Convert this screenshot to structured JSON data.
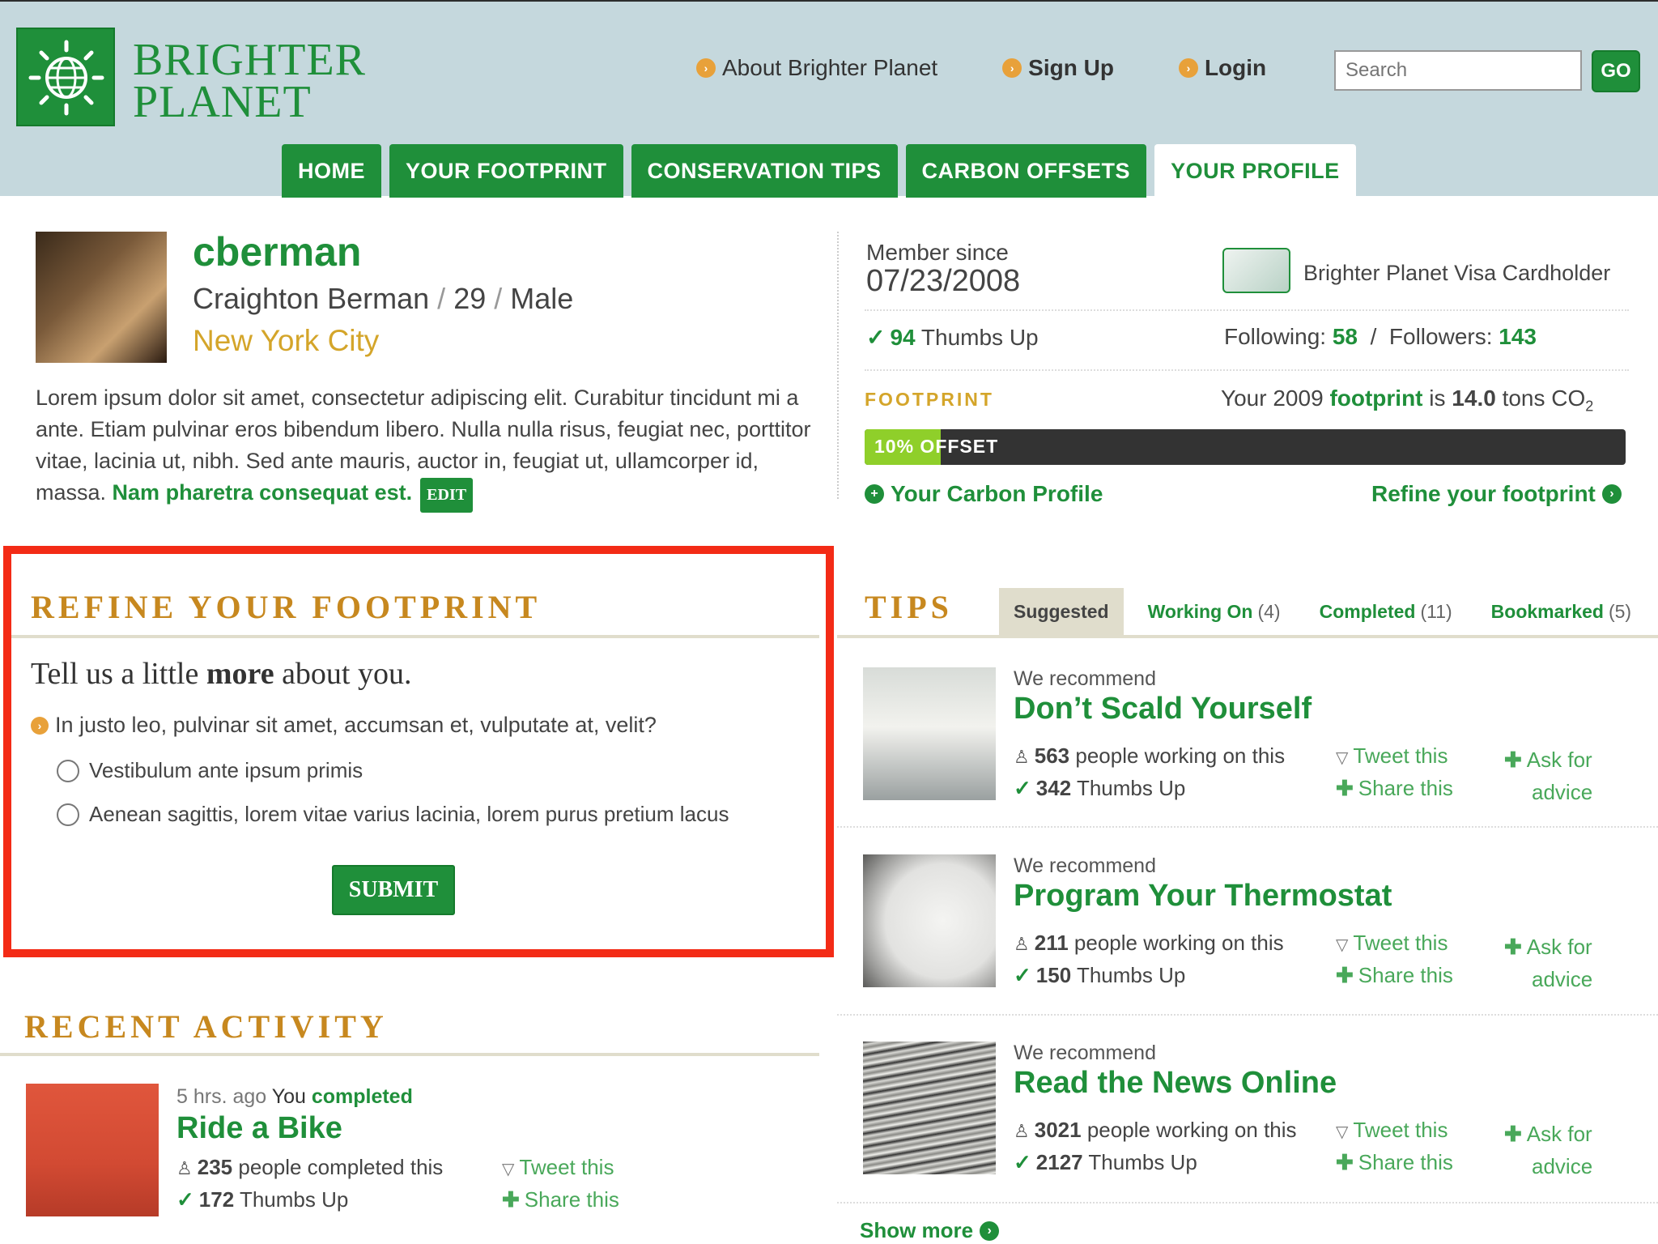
{
  "brand": {
    "name_line1": "BRIGHTER",
    "name_line2": "PLANET"
  },
  "header": {
    "links": [
      "About Brighter Planet",
      "Sign Up",
      "Login"
    ],
    "search_placeholder": "Search",
    "go_label": "GO"
  },
  "tabs": [
    {
      "label": "HOME",
      "active": false
    },
    {
      "label": "YOUR FOOTPRINT",
      "active": false
    },
    {
      "label": "CONSERVATION TIPS",
      "active": false
    },
    {
      "label": "CARBON OFFSETS",
      "active": false
    },
    {
      "label": "YOUR PROFILE",
      "active": true
    }
  ],
  "profile": {
    "username": "cberman",
    "full_name": "Craighton Berman",
    "age": "29",
    "gender": "Male",
    "sep": "/",
    "city": "New York City",
    "bio": "Lorem ipsum dolor sit amet, consectetur adipiscing elit. Curabitur tincidunt mi a ante. Etiam pulvinar eros bibendum libero. Nulla nulla risus, feugiat nec, porttitor vitae, lacinia ut, nibh. Sed ante mauris, auctor in, feugiat ut, ullamcorper id, massa.",
    "bio_link": "Nam pharetra consequat est.",
    "edit_label": "EDIT"
  },
  "stats": {
    "member_since_label": "Member since",
    "member_since": "07/23/2008",
    "visa_label": "Brighter Planet Visa Cardholder",
    "thumbs_up_count": "94",
    "thumbs_up_label": "Thumbs Up",
    "following_label": "Following:",
    "following": "58",
    "followers_label": "Followers:",
    "followers": "143",
    "slash": "/"
  },
  "footprint": {
    "label": "FOOTPRINT",
    "text_pre": "Your 2009",
    "text_link": "footprint",
    "text_is": "is",
    "value": "14.0",
    "text_unit": "tons CO",
    "text_sub": "2",
    "offset_label": "10% OFFSET",
    "offset_fraction": 0.1,
    "carbon_profile_link": "Your Carbon Profile",
    "refine_link": "Refine your footprint"
  },
  "refine": {
    "title": "REFINE YOUR FOOTPRINT",
    "tell_pre": "Tell us a little",
    "tell_bold": "more",
    "tell_post": "about you.",
    "question": "In justo leo, pulvinar sit amet, accumsan et, vulputate at, velit?",
    "options": [
      "Vestibulum ante ipsum primis",
      "Aenean sagittis, lorem vitae varius lacinia, lorem purus pretium lacus"
    ],
    "submit_label": "SUBMIT"
  },
  "tips": {
    "title": "TIPS",
    "tabs": [
      {
        "label": "Suggested",
        "count": "",
        "active": true
      },
      {
        "label": "Working On",
        "count": "(4)",
        "active": false
      },
      {
        "label": "Completed",
        "count": "(11)",
        "active": false
      },
      {
        "label": "Bookmarked",
        "count": "(5)",
        "active": false
      }
    ],
    "recommend_label": "We recommend",
    "people_suffix": "people working on this",
    "thumbs_suffix": "Thumbs Up",
    "tweet_label": "Tweet this",
    "share_label": "Share this",
    "ask_line1": "Ask for",
    "ask_line2": "advice",
    "items": [
      {
        "title": "Don’t Scald Yourself",
        "people": "563",
        "thumbs": "342"
      },
      {
        "title": "Program Your Thermostat",
        "people": "211",
        "thumbs": "150"
      },
      {
        "title": "Read the News Online",
        "people": "3021",
        "thumbs": "2127"
      }
    ],
    "show_more": "Show more"
  },
  "activity": {
    "title": "RECENT ACTIVITY",
    "time": "5 hrs. ago",
    "you": "You",
    "action": "completed",
    "item_title": "Ride a Bike",
    "people": "235",
    "people_suffix": "people completed this",
    "thumbs": "172",
    "thumbs_suffix": "Thumbs Up",
    "tweet_label": "Tweet this",
    "share_label": "Share this"
  },
  "colors": {
    "brand_green": "#1f8f3a",
    "accent_gold": "#c7881f",
    "header_bg": "#c5d8dd",
    "highlight_red": "#f32b16",
    "offset_green": "#8fcf2a"
  }
}
